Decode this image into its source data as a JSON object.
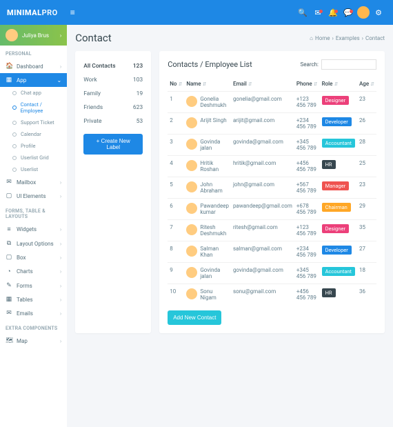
{
  "brand": {
    "prefix": "MINIMAL",
    "suffix": "PRO"
  },
  "user": {
    "name": "Juliya Brus"
  },
  "breadcrumb": {
    "home": "Home",
    "sec": "Examples",
    "page": "Contact"
  },
  "pageTitle": "Contact",
  "sidebar": {
    "sections": {
      "personal": "PERSONAL",
      "forms": "FORMS, TABLE & LAYOUTS",
      "extra": "EXTRA COMPONENTS"
    },
    "items": {
      "dashboard": "Dashboard",
      "app": "App",
      "mailbox": "Mailbox",
      "ui": "UI Elements",
      "widgets": "Widgets",
      "layout": "Layout Options",
      "box": "Box",
      "charts": "Charts",
      "forms": "Forms",
      "tables": "Tables",
      "emails": "Emails",
      "map": "Map"
    },
    "sub": {
      "chat": "Chat app",
      "contact": "Contact / Employee",
      "support": "Support Ticket",
      "calendar": "Calendar",
      "profile": "Profile",
      "grid": "Userlist Grid",
      "userlist": "Userlist"
    }
  },
  "labels": {
    "title": "All Contacts",
    "titleCount": "123",
    "rows": [
      {
        "name": "Work",
        "count": "103"
      },
      {
        "name": "Family",
        "count": "19"
      },
      {
        "name": "Friends",
        "count": "623"
      },
      {
        "name": "Private",
        "count": "53"
      }
    ],
    "btn": "+ Create New Label"
  },
  "table": {
    "title": "Contacts / Employee List",
    "searchLabel": "Search:",
    "headers": {
      "no": "No",
      "name": "Name",
      "email": "Email",
      "phone": "Phone",
      "role": "Role",
      "age": "Age"
    },
    "addBtn": "Add New Contact",
    "rows": [
      {
        "no": "1",
        "name": "Gonelia Deshmukh",
        "email": "gonelia@gmail.com",
        "phone": "+123 456 789",
        "role": "Designer",
        "roleColor": "#ec407a",
        "age": "23"
      },
      {
        "no": "2",
        "name": "Arijit Singh",
        "email": "arijit@gmail.com",
        "phone": "+234 456 789",
        "role": "Developer",
        "roleColor": "#1e88e5",
        "age": "26"
      },
      {
        "no": "3",
        "name": "Govinda jalan",
        "email": "govinda@gmail.com",
        "phone": "+345 456 789",
        "role": "Accountant",
        "roleColor": "#26c6da",
        "age": "28"
      },
      {
        "no": "4",
        "name": "Hritik Roshan",
        "email": "hritik@gmail.com",
        "phone": "+456 456 789",
        "role": "HR",
        "roleColor": "#37474f",
        "age": "25"
      },
      {
        "no": "5",
        "name": "John Abraham",
        "email": "john@gmail.com",
        "phone": "+567 456 789",
        "role": "Manager",
        "roleColor": "#ef5350",
        "age": "23"
      },
      {
        "no": "6",
        "name": "Pawandeep kumar",
        "email": "pawandeep@gmail.com",
        "phone": "+678 456 789",
        "role": "Chairman",
        "roleColor": "#ffa726",
        "age": "29"
      },
      {
        "no": "7",
        "name": "Ritesh Deshmukh",
        "email": "ritesh@gmail.com",
        "phone": "+123 456 789",
        "role": "Designer",
        "roleColor": "#ec407a",
        "age": "35"
      },
      {
        "no": "8",
        "name": "Salman Khan",
        "email": "salman@gmail.com",
        "phone": "+234 456 789",
        "role": "Developer",
        "roleColor": "#1e88e5",
        "age": "27"
      },
      {
        "no": "9",
        "name": "Govinda jalan",
        "email": "govinda@gmail.com",
        "phone": "+345 456 789",
        "role": "Accountant",
        "roleColor": "#26c6da",
        "age": "18"
      },
      {
        "no": "10",
        "name": "Sonu Nigam",
        "email": "sonu@gmail.com",
        "phone": "+456 456 789",
        "role": "HR",
        "roleColor": "#37474f",
        "age": "36"
      }
    ]
  }
}
